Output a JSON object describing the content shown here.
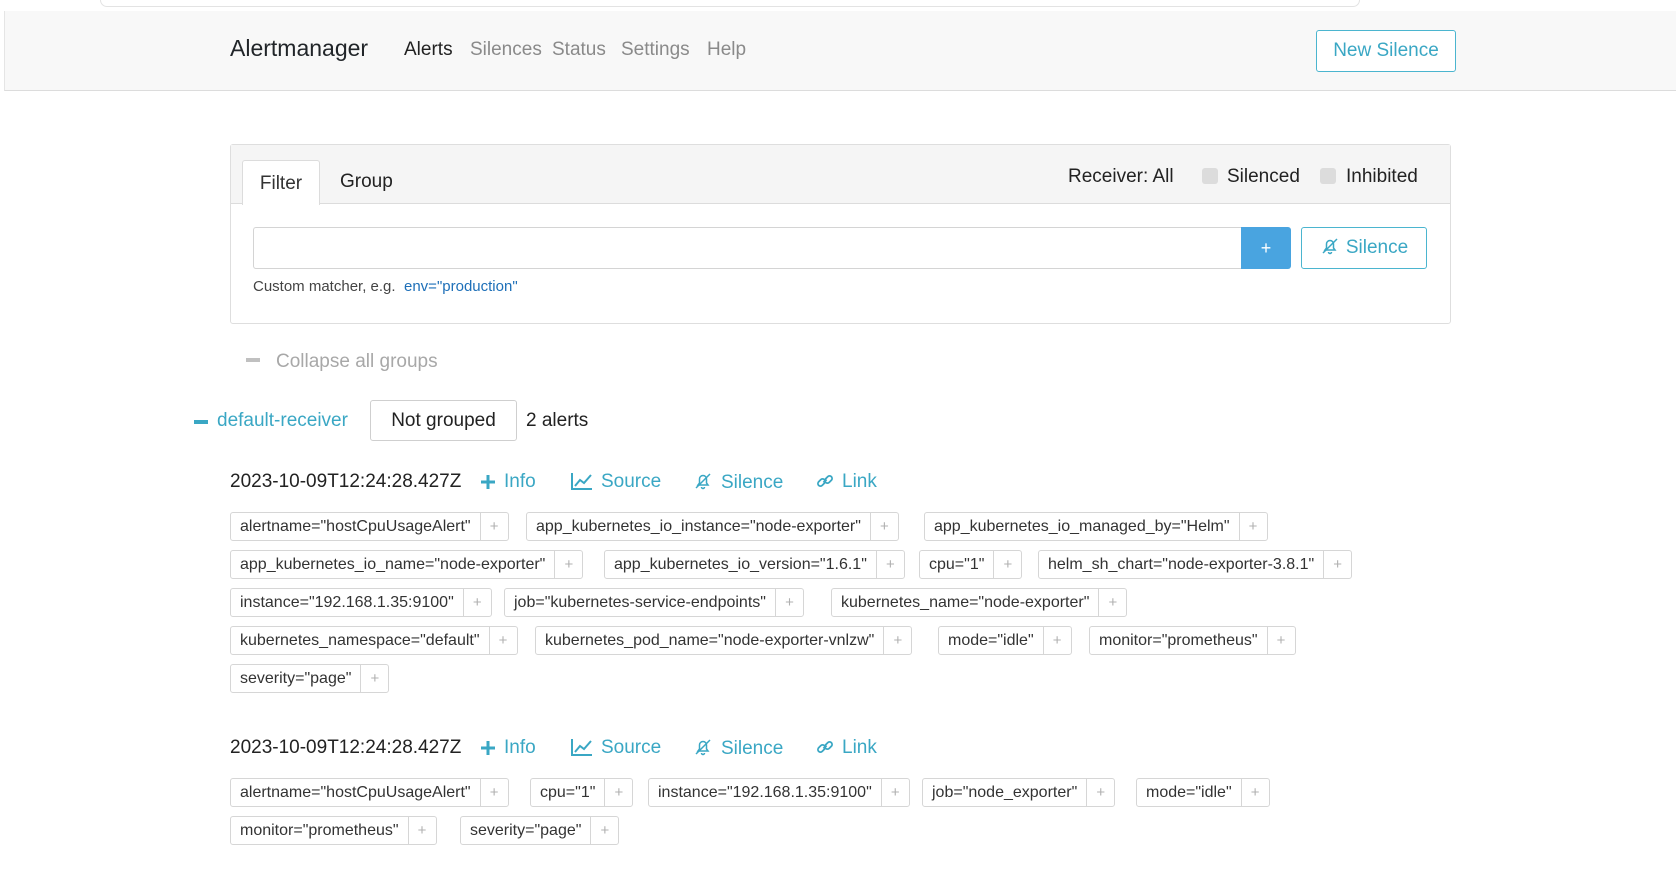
{
  "nav": {
    "brand": "Alertmanager",
    "items": [
      "Alerts",
      "Silences",
      "Status",
      "Settings",
      "Help"
    ],
    "new_silence": "New Silence"
  },
  "filter_panel": {
    "tabs": [
      "Filter",
      "Group"
    ],
    "receiver": "Receiver: All",
    "silenced_label": "Silenced",
    "inhibited_label": "Inhibited",
    "input_value": "",
    "add_label": "+",
    "silence_label": "Silence",
    "hint": "Custom matcher, e.g.",
    "hint_example": "env=\"production\""
  },
  "collapse_all": "Collapse all groups",
  "group": {
    "receiver": "default-receiver",
    "grouping": "Not grouped",
    "count": "2 alerts"
  },
  "actions": {
    "info": "Info",
    "source": "Source",
    "silence": "Silence",
    "link": "Link"
  },
  "alerts": [
    {
      "timestamp": "2023-10-09T12:24:28.427Z",
      "labels": [
        "alertname=\"hostCpuUsageAlert\"",
        "app_kubernetes_io_instance=\"node-exporter\"",
        "app_kubernetes_io_managed_by=\"Helm\"",
        "app_kubernetes_io_name=\"node-exporter\"",
        "app_kubernetes_io_version=\"1.6.1\"",
        "cpu=\"1\"",
        "helm_sh_chart=\"node-exporter-3.8.1\"",
        "instance=\"192.168.1.35:9100\"",
        "job=\"kubernetes-service-endpoints\"",
        "kubernetes_name=\"node-exporter\"",
        "kubernetes_namespace=\"default\"",
        "kubernetes_pod_name=\"node-exporter-vnlzw\"",
        "mode=\"idle\"",
        "monitor=\"prometheus\"",
        "severity=\"page\""
      ]
    },
    {
      "timestamp": "2023-10-09T12:24:28.427Z",
      "labels": [
        "alertname=\"hostCpuUsageAlert\"",
        "cpu=\"1\"",
        "instance=\"192.168.1.35:9100\"",
        "job=\"node_exporter\"",
        "mode=\"idle\"",
        "monitor=\"prometheus\"",
        "severity=\"page\""
      ]
    }
  ],
  "chip_add_glyph": "+"
}
